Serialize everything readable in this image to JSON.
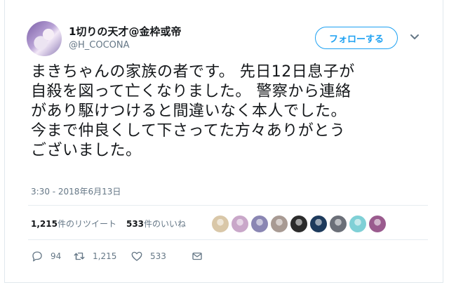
{
  "user": {
    "display_name": "1切りの天才@金枠或帝",
    "handle": "@H_COCONA"
  },
  "follow_button": {
    "label": "フォローする"
  },
  "tweet": {
    "text": "まきちゃんの家族の者です。 先日12日息子が\n自殺を図って亡くなりました。 警察から連絡\nがあり駆けつけると間違いなく本人でした。\n今まで仲良くして下さってた方々ありがとう\nございました。",
    "timestamp": "3:30 - 2018年6月13日"
  },
  "stats": {
    "retweets_count": "1,215",
    "retweets_label": "件のリツイート",
    "likes_count": "533",
    "likes_label": "件のいいね"
  },
  "likers": [
    {
      "color": "#d9c7a8"
    },
    {
      "color": "#c9a7c9"
    },
    {
      "color": "#8a86b3"
    },
    {
      "color": "#a89a93"
    },
    {
      "color": "#2b2b2b"
    },
    {
      "color": "#1d3a5c"
    },
    {
      "color": "#6b6f78"
    },
    {
      "color": "#7fd0d6"
    },
    {
      "color": "#9a5b8e"
    }
  ],
  "actions": {
    "reply_count": "94",
    "retweet_count": "1,215",
    "like_count": "533"
  },
  "colors": {
    "accent": "#1da1f2",
    "text": "#14171a",
    "muted": "#657786",
    "border": "#e6ecf0"
  }
}
